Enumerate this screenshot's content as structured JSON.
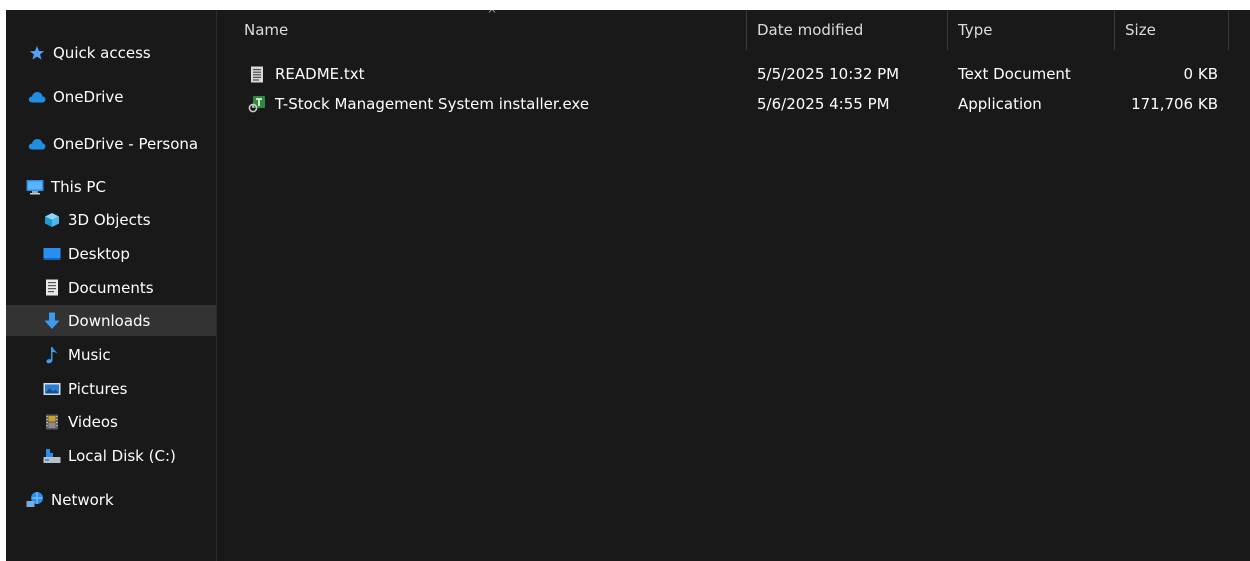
{
  "sidebar": {
    "items": [
      {
        "label": "Quick access",
        "icon": "star-icon"
      },
      {
        "label": "OneDrive",
        "icon": "cloud-icon"
      },
      {
        "label": "OneDrive - Persona",
        "icon": "cloud-icon"
      },
      {
        "label": "This PC",
        "icon": "monitor-icon"
      },
      {
        "label": "3D Objects",
        "icon": "cube-icon"
      },
      {
        "label": "Desktop",
        "icon": "desktop-icon"
      },
      {
        "label": "Documents",
        "icon": "document-icon"
      },
      {
        "label": "Downloads",
        "icon": "download-arrow-icon"
      },
      {
        "label": "Music",
        "icon": "music-note-icon"
      },
      {
        "label": "Pictures",
        "icon": "pictures-icon"
      },
      {
        "label": "Videos",
        "icon": "film-icon"
      },
      {
        "label": "Local Disk (C:)",
        "icon": "drive-icon"
      },
      {
        "label": "Network",
        "icon": "network-icon"
      }
    ],
    "selected": "Downloads"
  },
  "file_list": {
    "sort_indicator": "^",
    "columns": [
      {
        "label": "Name"
      },
      {
        "label": "Date modified"
      },
      {
        "label": "Type"
      },
      {
        "label": "Size"
      }
    ],
    "rows": [
      {
        "name": "README.txt",
        "date": "5/5/2025 10:32 PM",
        "type": "Text Document",
        "size": "0 KB",
        "icon": "text-file-icon"
      },
      {
        "name": "T-Stock Management System installer.exe",
        "date": "5/6/2025 4:55 PM",
        "type": "Application",
        "size": "171,706 KB",
        "icon": "installer-app-icon"
      }
    ]
  },
  "colors": {
    "background": "#191919",
    "selected_row": "#333333",
    "text": "#ffffff",
    "header_text": "#dcdcdc",
    "onedrive_blue": "#1e8fe1",
    "downloads_blue": "#3c9af0"
  }
}
